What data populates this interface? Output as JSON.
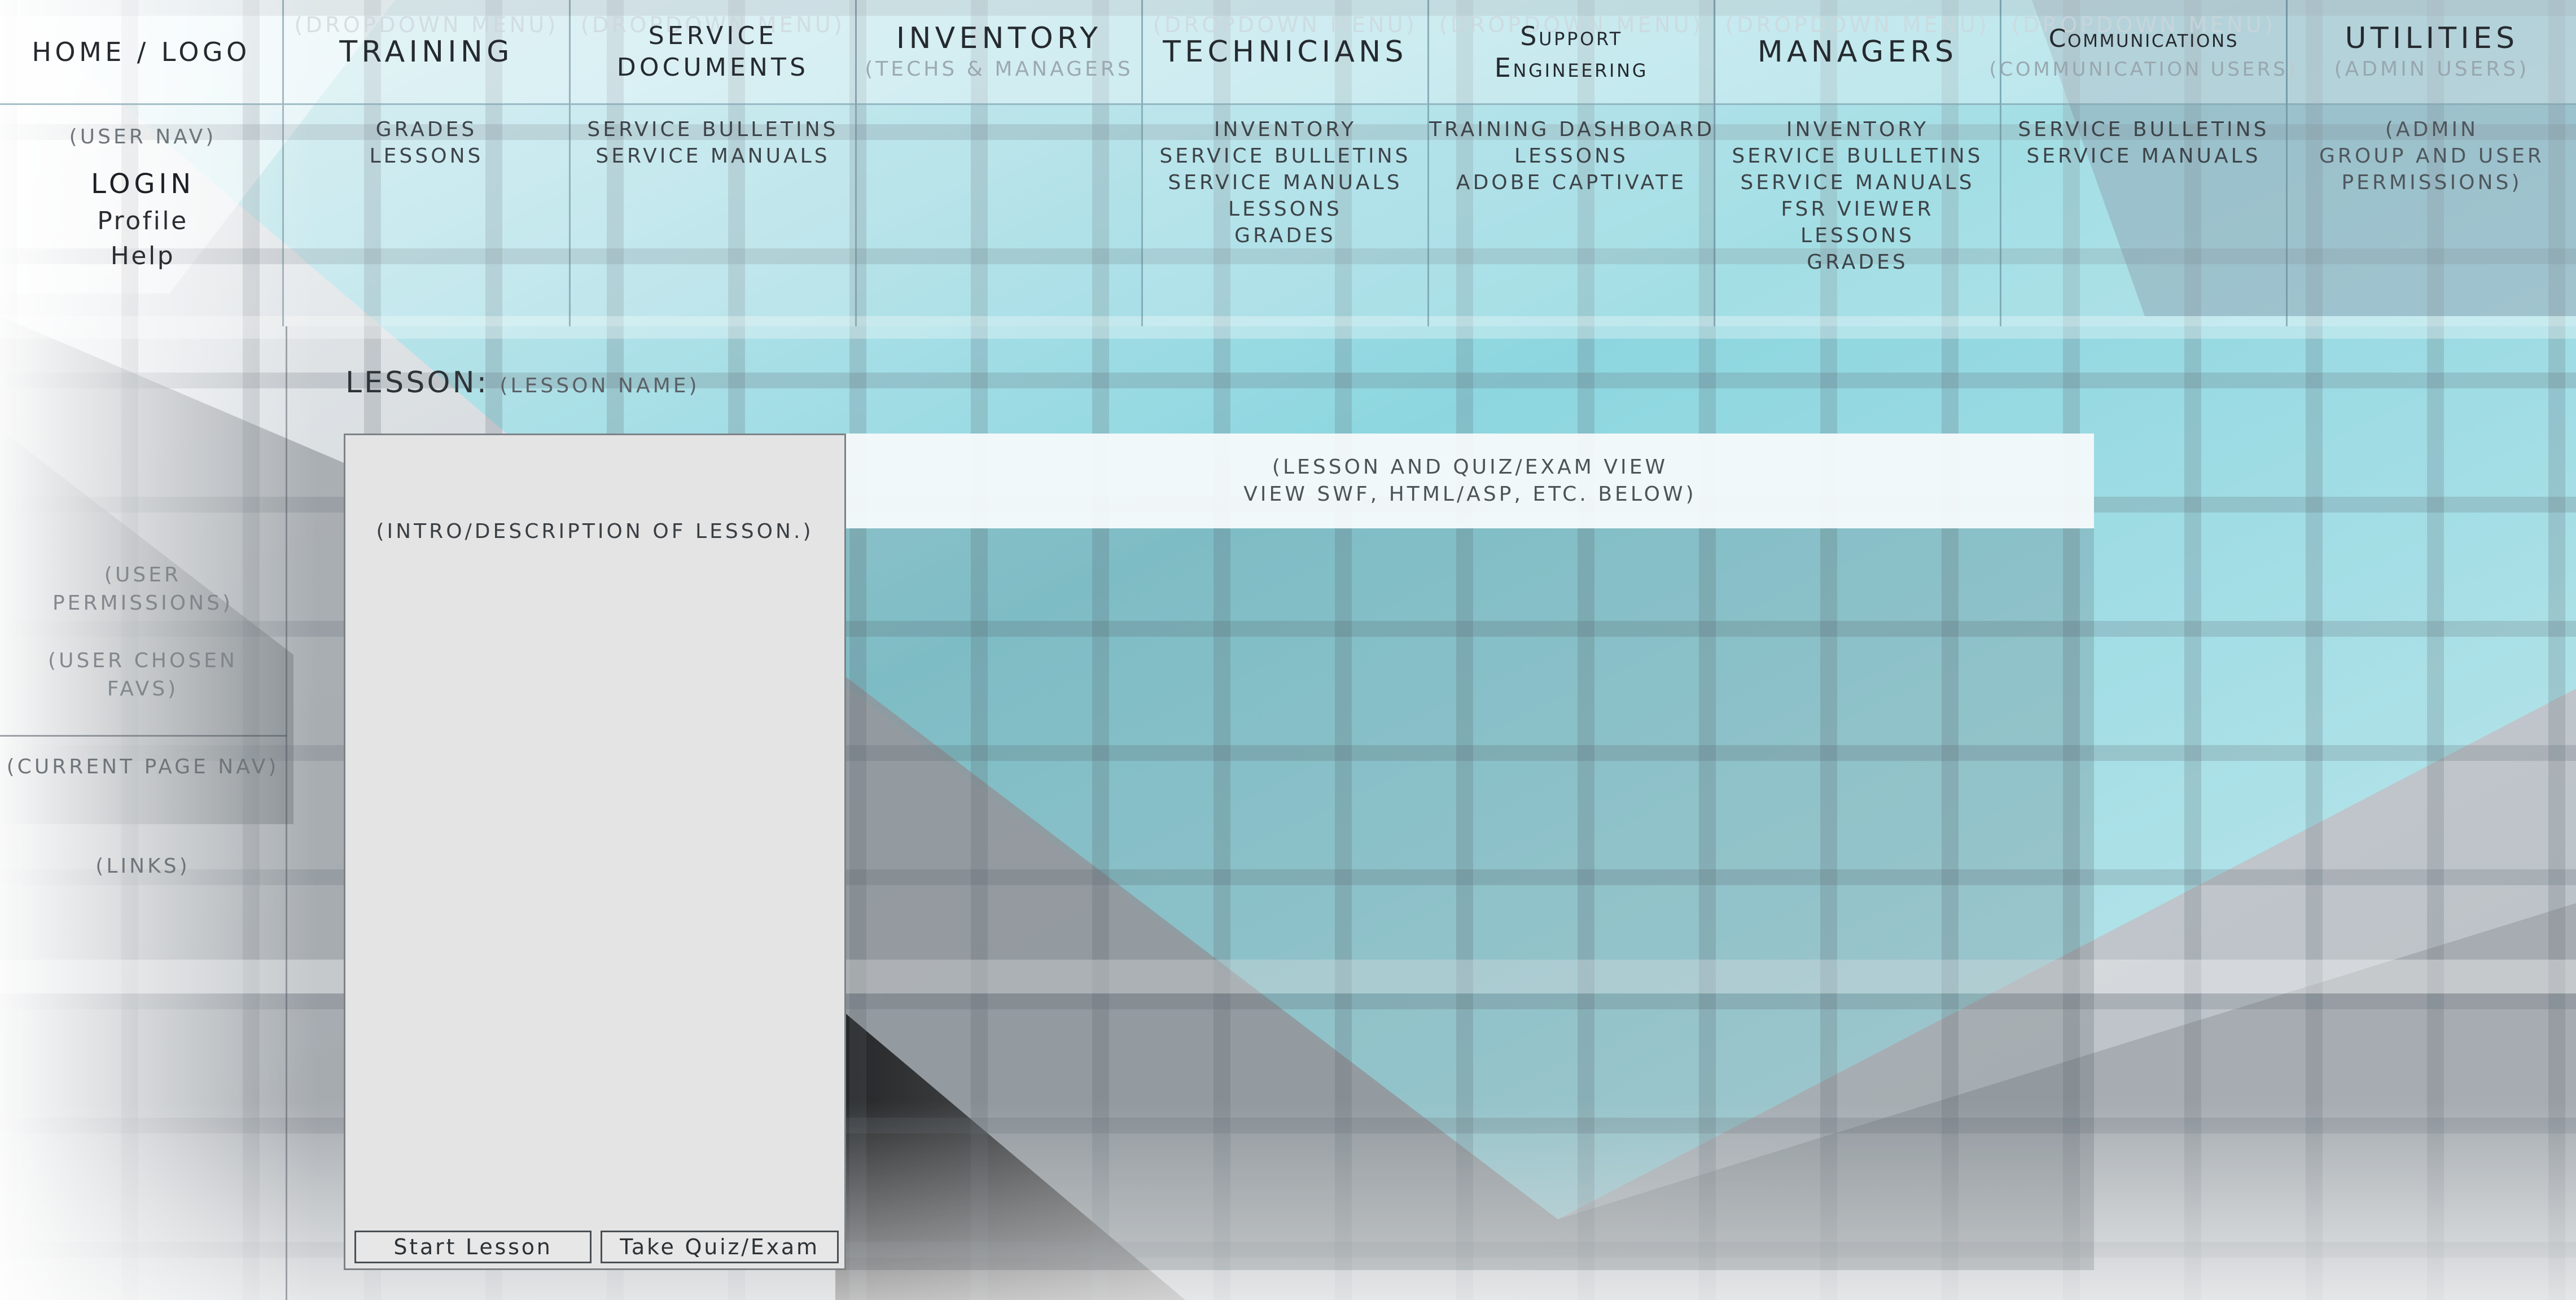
{
  "home": {
    "label": "Home / Logo"
  },
  "nav": [
    {
      "hint": "(Dropdown Menu)",
      "title": "Training",
      "sub": "",
      "items": [
        "Grades",
        "Lessons"
      ]
    },
    {
      "hint": "(Dropdown Menu)",
      "title": "Service\nDocuments",
      "sub": "",
      "items": [
        "Service Bulletins",
        "Service Manuals"
      ]
    },
    {
      "hint": "",
      "title": "Inventory",
      "sub": "(Techs & Managers",
      "items": []
    },
    {
      "hint": "(Dropdown Menu)",
      "title": "Technicians",
      "sub": "",
      "items": [
        "Inventory",
        "Service Bulletins",
        "Service Manuals",
        "Lessons",
        "Grades"
      ]
    },
    {
      "hint": "(Dropdown Menu)",
      "title": "Support\nEngineering",
      "sub": "",
      "items": [
        "Training Dashboard",
        "Lessons",
        "Adobe Captivate"
      ]
    },
    {
      "hint": "(Dropdown Menu)",
      "title": "Managers",
      "sub": "",
      "items": [
        "Inventory",
        "Service Bulletins",
        "Service Manuals",
        "FSR Viewer",
        "Lessons",
        "Grades"
      ]
    },
    {
      "hint": "(Dropdown Menu)",
      "title": "Communications",
      "sub": "(Communication Users)",
      "items": [
        "Service Bulletins",
        "Service Manuals"
      ]
    },
    {
      "hint": "",
      "title": "Utilities",
      "sub": "(Admin Users)",
      "items": [],
      "note": "(Admin\nGroup and User\nPermissions)"
    }
  ],
  "user_panel": {
    "nav_hint": "(User Nav)",
    "login": "Login",
    "profile": "Profile",
    "help": "Help",
    "permissions_hint": "(User\nPermissions)",
    "favs_hint": "(User Chosen\nFavs)",
    "current_nav_hint": "(Current Page Nav)",
    "links_hint": "(Links)"
  },
  "lesson": {
    "label": "Lesson:",
    "name": "(Lesson Name)",
    "intro": "(Intro/Description of Lesson.)",
    "start_button": "Start Lesson",
    "quiz_button": "Take Quiz/Exam"
  },
  "viewer": {
    "line1": "(Lesson and Quiz/Exam View",
    "line2": "View SWF, HTML/ASP, etc. below)"
  },
  "colors": {
    "accent_teal": "#7fd6e0",
    "panel_gray": "#e4e4e4",
    "dark_gray": "#2b2b2b"
  }
}
